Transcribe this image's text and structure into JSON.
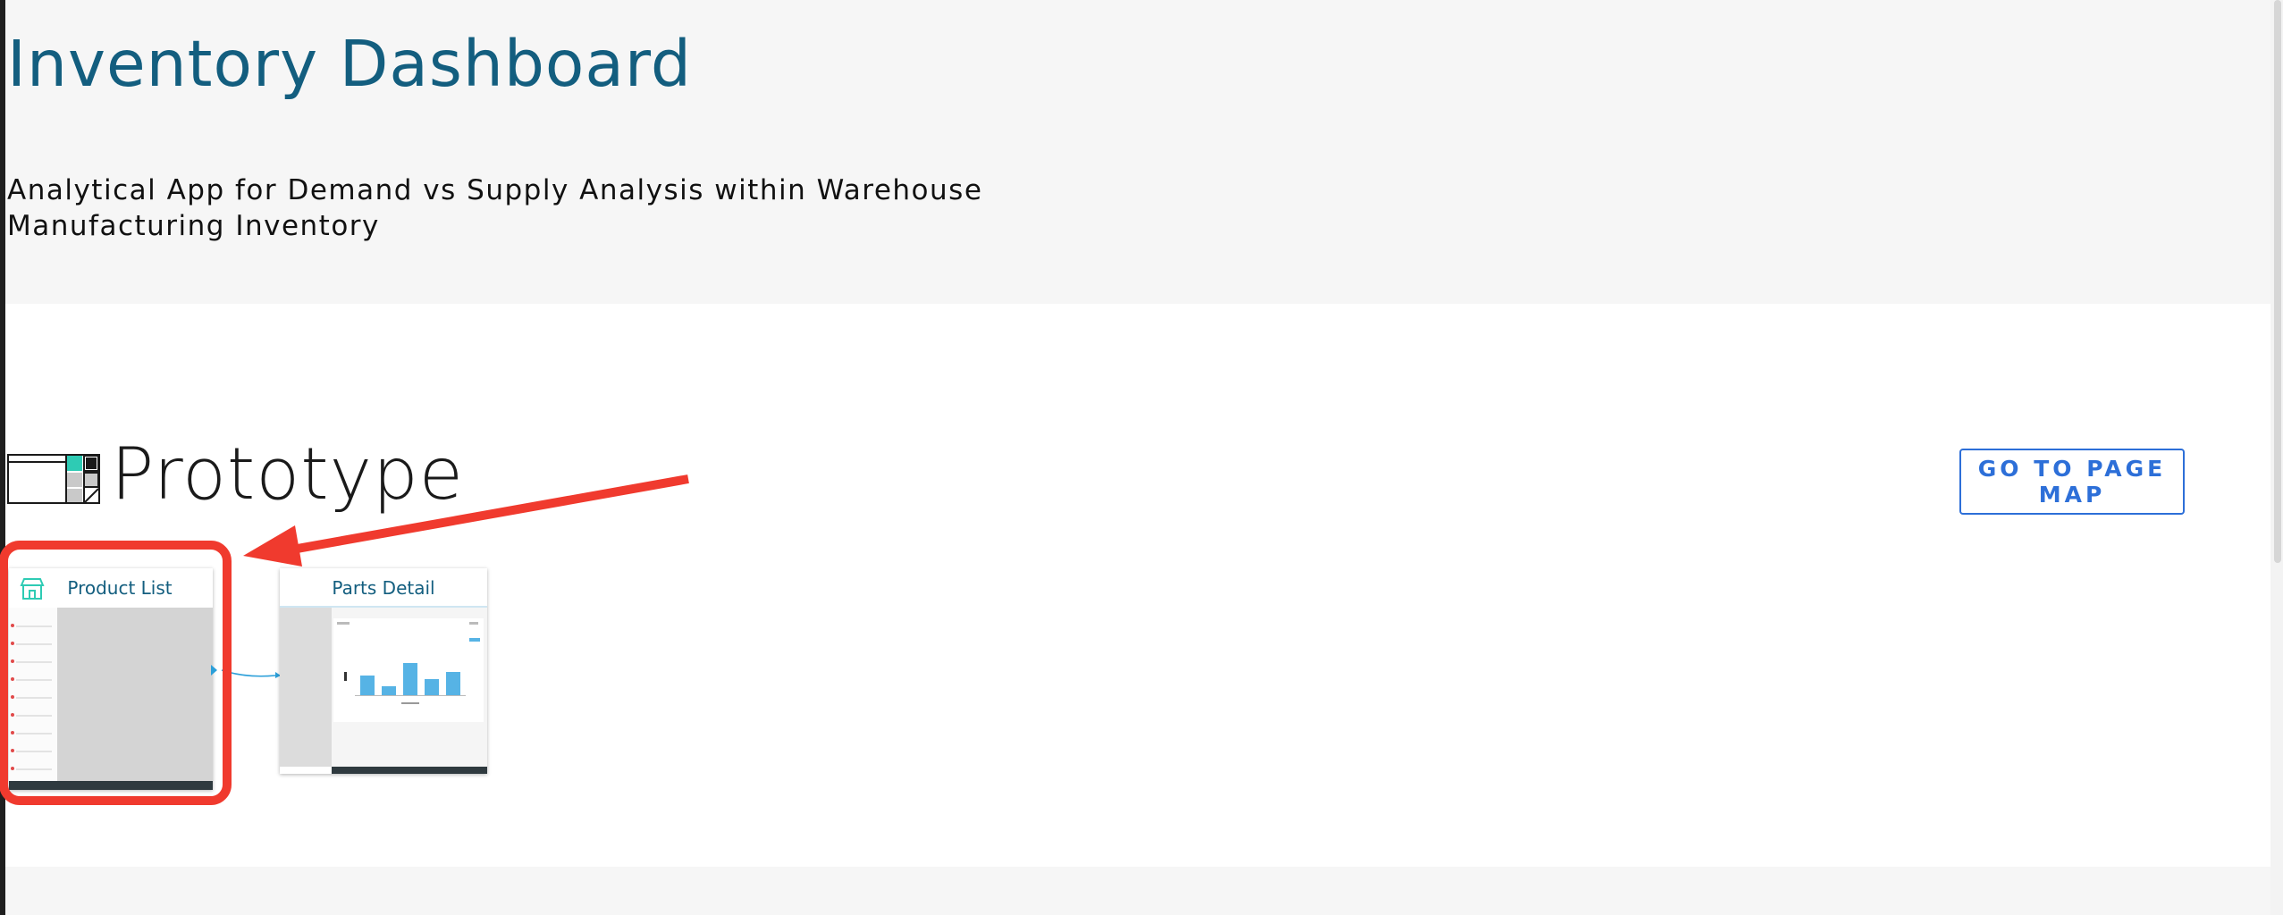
{
  "header": {
    "title": "Inventory Dashboard",
    "description": "Analytical App for Demand vs Supply Analysis within Warehouse Manufacturing Inventory"
  },
  "prototype": {
    "section_title": "Prototype",
    "page_map_button": "GO TO PAGE MAP",
    "screens": [
      {
        "name": "Product List",
        "icon": "store-icon"
      },
      {
        "name": "Parts Detail",
        "icon": "bar-chart-thumbnail"
      }
    ]
  },
  "colors": {
    "title": "#135e7f",
    "accent_button": "#2d6fd8",
    "annotation": "#f03a2e",
    "chart_bars": "#56b3e5",
    "header_bg": "#f6f6f6"
  }
}
